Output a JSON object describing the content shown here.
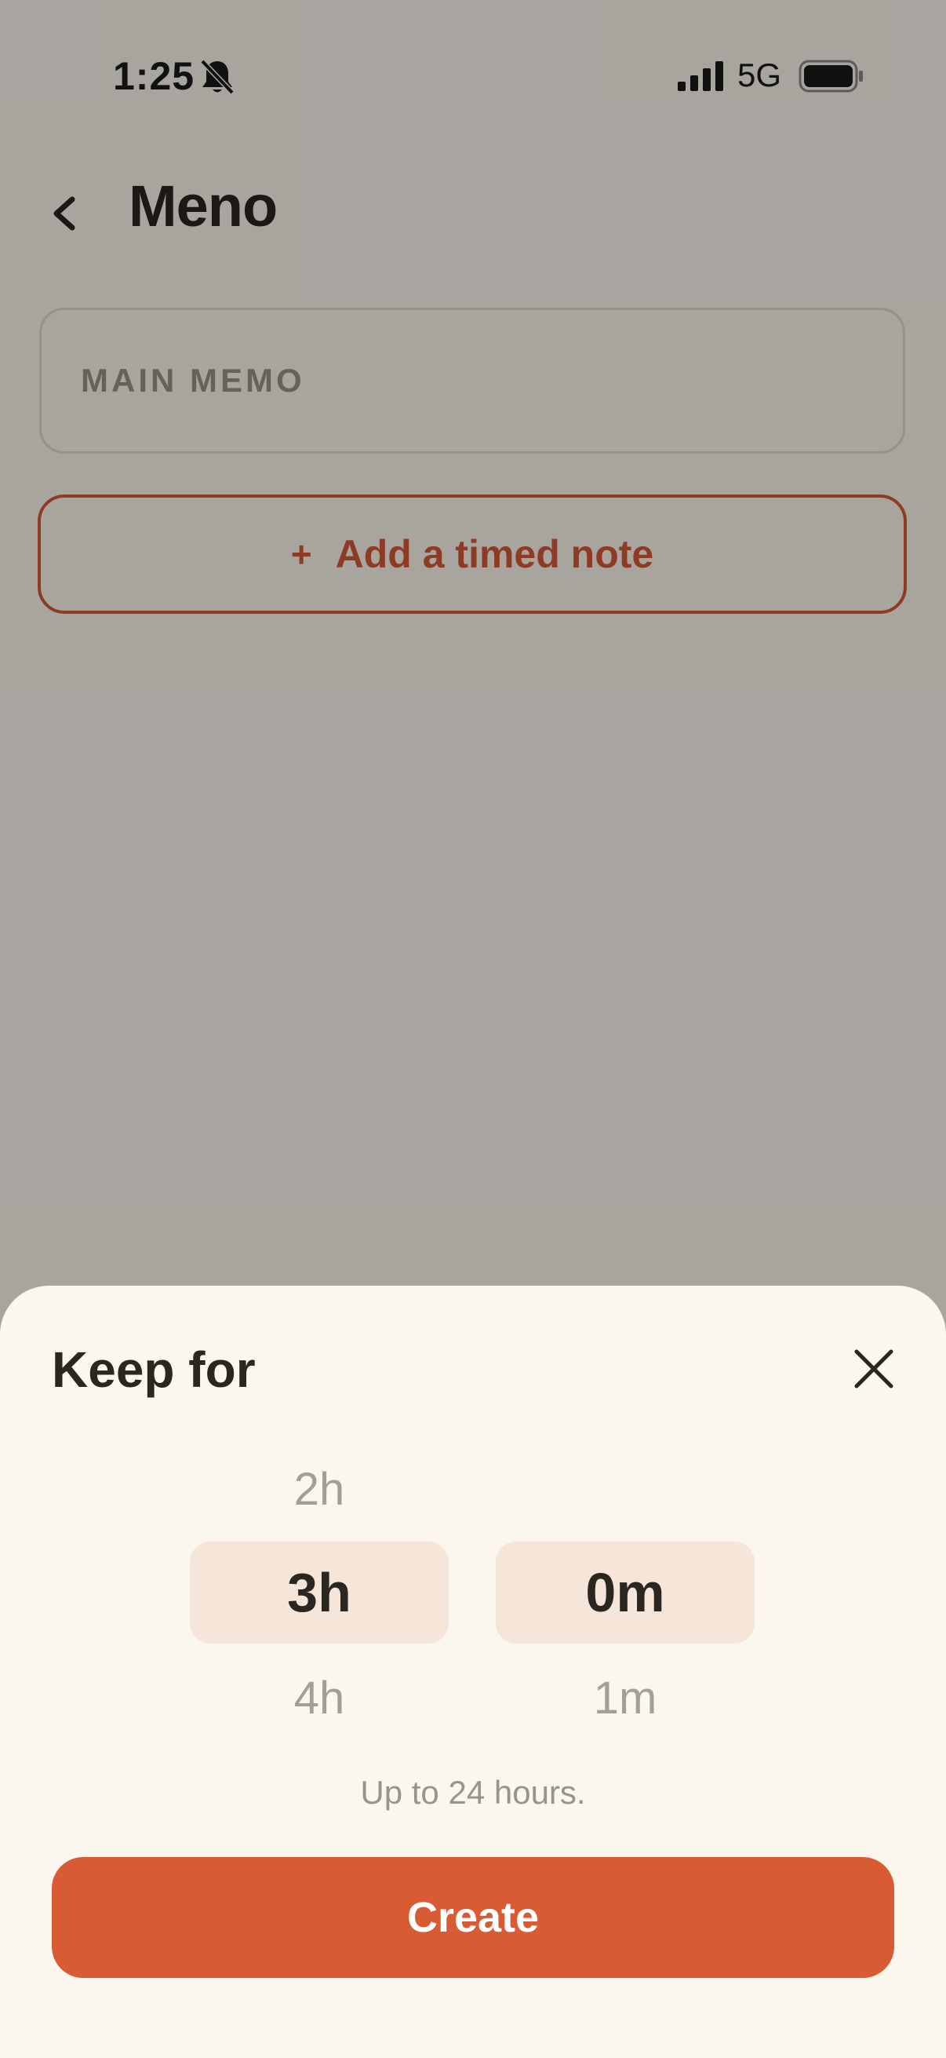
{
  "status_bar": {
    "time": "1:25",
    "network": "5G",
    "icons": [
      "bell-slash-icon",
      "cellular-signal-icon",
      "battery-icon"
    ]
  },
  "header": {
    "back_icon": "chevron-left-icon",
    "title": "Meno"
  },
  "main": {
    "memo_label": "MAIN MEMO",
    "add_note": {
      "icon": "+",
      "label": "Add a timed note"
    }
  },
  "sheet": {
    "title": "Keep for",
    "close_icon": "close-icon",
    "hours": {
      "above": "2h",
      "selected": "3h",
      "below": "4h"
    },
    "minutes": {
      "selected": "0m",
      "below": "1m"
    },
    "helper": "Up to 24 hours.",
    "create_label": "Create"
  },
  "colors": {
    "accent": "#d95b33",
    "sheet_background": "#fbf6ee",
    "selected_pill": "#f6e6da",
    "text_dark": "#2a2620"
  }
}
